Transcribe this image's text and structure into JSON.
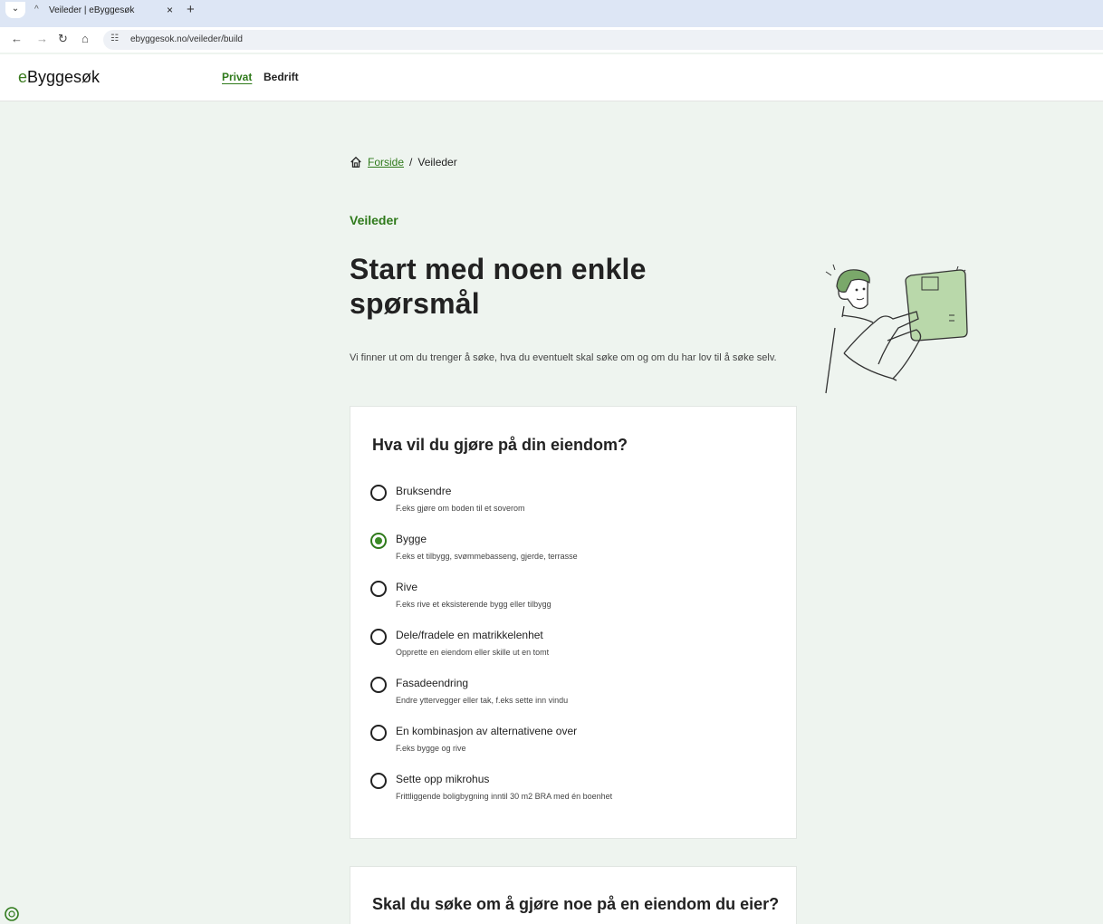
{
  "browser": {
    "tab_dropdown": "⌄",
    "tab_title": "Veileder | eByggesøk",
    "tab_close": "×",
    "new_tab": "+",
    "url": "ebyggesok.no/veileder/build"
  },
  "header": {
    "logo_e": "e",
    "logo_rest": "Byggesøk",
    "nav": [
      {
        "label": "Privat",
        "active": true
      },
      {
        "label": "Bedrift",
        "active": false
      }
    ]
  },
  "breadcrumb": {
    "home": "Forside",
    "separator": "/",
    "current": "Veileder"
  },
  "hero": {
    "eyebrow": "Veileder",
    "title": "Start med noen enkle spørsmål",
    "description": "Vi finner ut om du trenger å søke, hva du eventuelt skal søke om og om du har lov til å søke selv."
  },
  "question1": {
    "title": "Hva vil du gjøre på din eiendom?",
    "selected": "Bygge",
    "options": [
      {
        "label": "Bruksendre",
        "help": "F.eks gjøre om boden til et soverom"
      },
      {
        "label": "Bygge",
        "help": "F.eks et tilbygg, svømmebasseng, gjerde, terrasse"
      },
      {
        "label": "Rive",
        "help": "F.eks rive et eksisterende bygg eller tilbygg"
      },
      {
        "label": "Dele/fradele en matrikkelenhet",
        "help": "Opprette en eiendom eller skille ut en tomt"
      },
      {
        "label": "Fasadeendring",
        "help": "Endre yttervegger eller tak, f.eks sette inn vindu"
      },
      {
        "label": "En kombinasjon av alternativene over",
        "help": "F.eks bygge og rive"
      },
      {
        "label": "Sette opp mikrohus",
        "help": "Frittliggende boligbygning inntil 30 m2 BRA med én boenhet"
      }
    ]
  },
  "question2": {
    "title": "Skal du søke om å gjøre noe på en eiendom du eier?"
  },
  "colors": {
    "accent": "#2f7a1b",
    "background": "#eef4ef"
  }
}
